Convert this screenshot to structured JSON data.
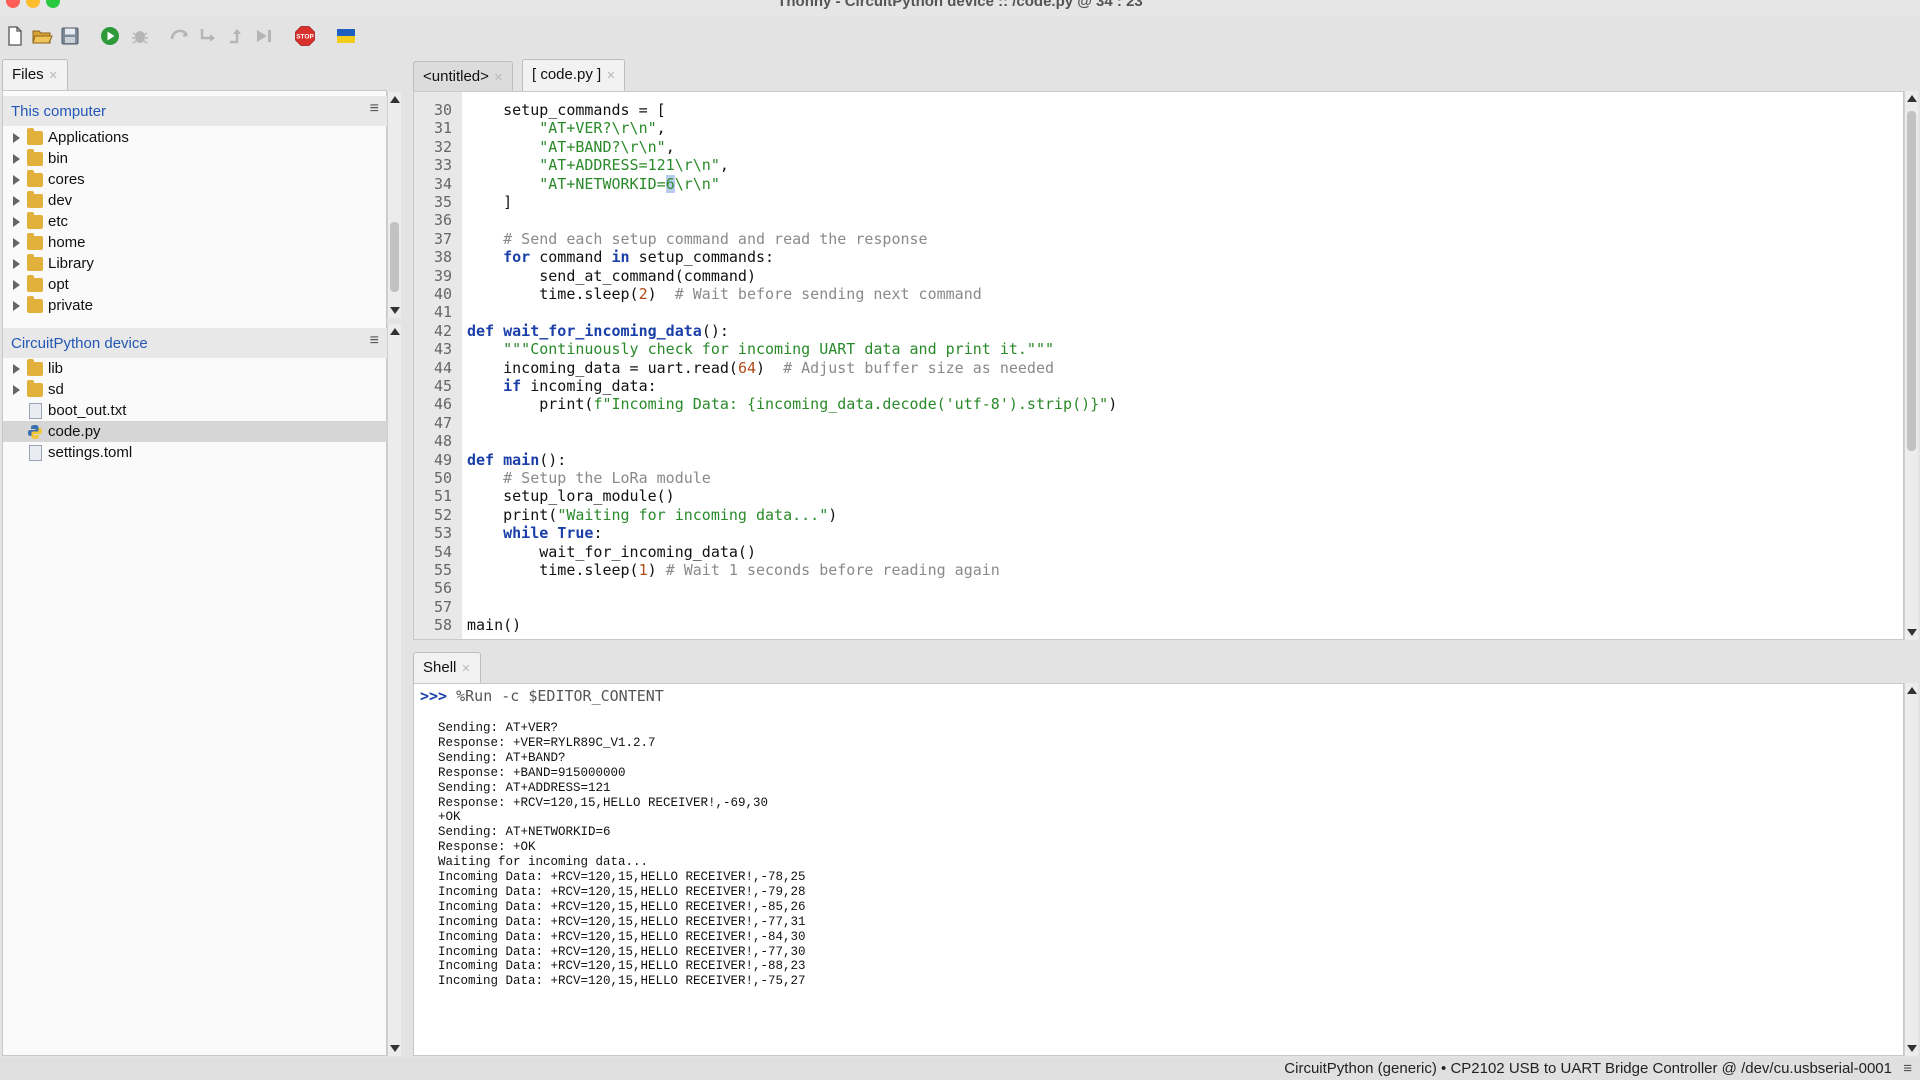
{
  "window": {
    "title": "Thonny - CircuitPython device :: /code.py @ 34 : 23"
  },
  "toolbar": {
    "new_file": "new-file-icon",
    "open": "open-folder-icon",
    "save": "save-icon",
    "run": "run-icon",
    "debug": "debug-icon",
    "step_over": "step-over-icon",
    "step_into": "step-into-icon",
    "step_out": "step-out-icon",
    "resume": "resume-icon",
    "stop": "stop-icon",
    "stop_label": "STOP",
    "flag": "ukraine-flag-icon"
  },
  "files_panel": {
    "tab_label": "Files",
    "this_computer": {
      "title": "This computer",
      "items": [
        "Applications",
        "bin",
        "cores",
        "dev",
        "etc",
        "home",
        "Library",
        "opt",
        "private"
      ]
    },
    "device": {
      "title": "CircuitPython device",
      "folders": [
        "lib",
        "sd"
      ],
      "files": [
        "boot_out.txt",
        "code.py",
        "settings.toml"
      ],
      "selected": "code.py"
    }
  },
  "editor": {
    "tabs": [
      {
        "label": "<untitled>",
        "active": false
      },
      {
        "label": "[ code.py ]",
        "active": true
      }
    ],
    "lines": [
      {
        "n": "30",
        "t": "    setup_commands = ["
      },
      {
        "n": "31",
        "t": "        \"AT+VER?\\r\\n\","
      },
      {
        "n": "32",
        "t": "        \"AT+BAND?\\r\\n\","
      },
      {
        "n": "33",
        "t": "        \"AT+ADDRESS=121\\r\\n\","
      },
      {
        "n": "34",
        "t": "        \"AT+NETWORKID=6\\r\\n\""
      },
      {
        "n": "35",
        "t": "    ]"
      },
      {
        "n": "36",
        "t": ""
      },
      {
        "n": "37",
        "t": "    # Send each setup command and read the response"
      },
      {
        "n": "38",
        "t": "    for command in setup_commands:"
      },
      {
        "n": "39",
        "t": "        send_at_command(command)"
      },
      {
        "n": "40",
        "t": "        time.sleep(2)  # Wait before sending next command"
      },
      {
        "n": "41",
        "t": ""
      },
      {
        "n": "42",
        "t": "def wait_for_incoming_data():"
      },
      {
        "n": "43",
        "t": "    \"\"\"Continuously check for incoming UART data and print it.\"\"\""
      },
      {
        "n": "44",
        "t": "    incoming_data = uart.read(64)  # Adjust buffer size as needed"
      },
      {
        "n": "45",
        "t": "    if incoming_data:"
      },
      {
        "n": "46",
        "t": "        print(f\"Incoming Data: {incoming_data.decode('utf-8').strip()}\")"
      },
      {
        "n": "47",
        "t": ""
      },
      {
        "n": "48",
        "t": ""
      },
      {
        "n": "49",
        "t": "def main():"
      },
      {
        "n": "50",
        "t": "    # Setup the LoRa module"
      },
      {
        "n": "51",
        "t": "    setup_lora_module()"
      },
      {
        "n": "52",
        "t": "    print(\"Waiting for incoming data...\")"
      },
      {
        "n": "53",
        "t": "    while True:"
      },
      {
        "n": "54",
        "t": "        wait_for_incoming_data()"
      },
      {
        "n": "55",
        "t": "        time.sleep(1) # Wait 1 seconds before reading again"
      },
      {
        "n": "56",
        "t": ""
      },
      {
        "n": "57",
        "t": ""
      },
      {
        "n": "58",
        "t": "main()"
      }
    ]
  },
  "shell": {
    "tab_label": "Shell",
    "prompt": ">>>",
    "command": "%Run -c $EDITOR_CONTENT",
    "output": [
      "Sending: AT+VER?",
      "Response: +VER=RYLR89C_V1.2.7",
      "Sending: AT+BAND?",
      "Response: +BAND=915000000",
      "Sending: AT+ADDRESS=121",
      "Response: +RCV=120,15,HELLO RECEIVER!,-69,30",
      "+OK",
      "Sending: AT+NETWORKID=6",
      "Response: +OK",
      "Waiting for incoming data...",
      "Incoming Data: +RCV=120,15,HELLO RECEIVER!,-78,25",
      "Incoming Data: +RCV=120,15,HELLO RECEIVER!,-79,28",
      "Incoming Data: +RCV=120,15,HELLO RECEIVER!,-85,26",
      "Incoming Data: +RCV=120,15,HELLO RECEIVER!,-77,31",
      "Incoming Data: +RCV=120,15,HELLO RECEIVER!,-84,30",
      "Incoming Data: +RCV=120,15,HELLO RECEIVER!,-77,30",
      "Incoming Data: +RCV=120,15,HELLO RECEIVER!,-88,23",
      "Incoming Data: +RCV=120,15,HELLO RECEIVER!,-75,27"
    ]
  },
  "statusbar": {
    "text": "CircuitPython (generic)  •  CP2102 USB to UART Bridge Controller @ /dev/cu.usbserial-0001"
  },
  "colors": {
    "keyword": "#1b3fa8",
    "string": "#2a8a2a",
    "comment": "#8a8a8a",
    "number": "#b04a1a",
    "section_title": "#2257b5",
    "stop_button": "#d9302c",
    "folder": "#e2b13c"
  }
}
